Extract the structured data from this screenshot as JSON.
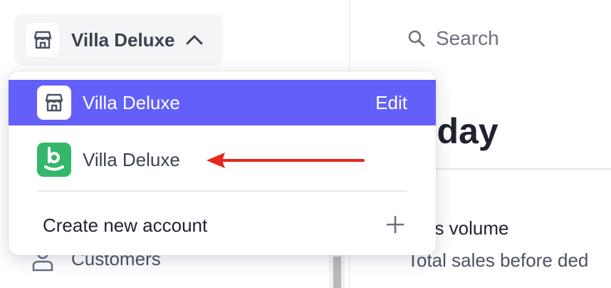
{
  "switcher": {
    "account_name": "Villa Deluxe",
    "icon": "store-icon",
    "chevron": "chevron-up-icon"
  },
  "sidebar": {
    "customers_label": "Customers",
    "customers_icon": "person-icon"
  },
  "search": {
    "label": "Search",
    "icon": "search-icon"
  },
  "main": {
    "title_visible": "oday",
    "metric_label_visible": "oss volume",
    "metric_sub_visible": "Total sales before ded"
  },
  "dropdown": {
    "items": [
      {
        "name": "Villa Deluxe",
        "icon": "store-icon",
        "action": "Edit",
        "active": true
      },
      {
        "name": "Villa Deluxe",
        "icon": "b-logo-icon",
        "active": false
      }
    ],
    "create_label": "Create new account",
    "create_icon": "plus-icon"
  },
  "colors": {
    "accent": "#6360fa",
    "green_logo": "#34b76a",
    "annotation_arrow": "#e8261b"
  }
}
